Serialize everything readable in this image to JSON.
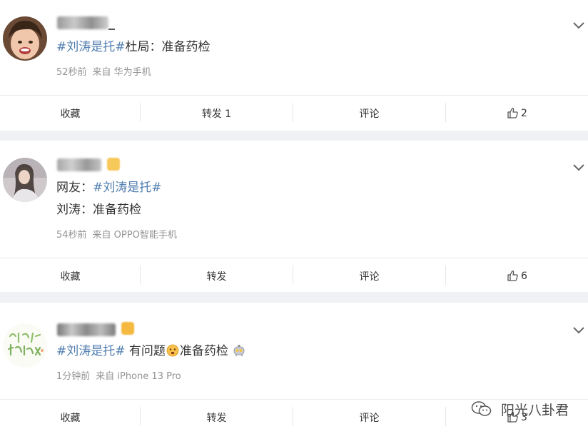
{
  "posts": [
    {
      "content": {
        "tag": "#刘涛是托#",
        "text": "杜局：准备药检"
      },
      "meta": {
        "time": "52秒前",
        "source": "来自 华为手机"
      },
      "actions": {
        "fav": "收藏",
        "repost": "转发 1",
        "comment": "评论",
        "like_count": "2"
      }
    },
    {
      "content": {
        "line1_prefix": "网友：",
        "tag": "#刘涛是托#",
        "line2": "刘涛：准备药检"
      },
      "meta": {
        "time": "54秒前",
        "source": "来自 OPPO智能手机"
      },
      "actions": {
        "fav": "收藏",
        "repost": "转发",
        "comment": "评论",
        "like_count": "6"
      }
    },
    {
      "content": {
        "tag": "#刘涛是托#",
        "text_a": "有问题",
        "text_b": "准备药检"
      },
      "meta": {
        "time": "1分钟前",
        "source": "来自 iPhone 13 Pro"
      },
      "actions": {
        "fav": "收藏",
        "repost": "转发",
        "comment": "评论",
        "like_count": "3"
      }
    }
  ],
  "watermark": {
    "label": "阳光八卦君",
    "icon": "wechat-icon"
  },
  "colors": {
    "tag": "#507daf",
    "meta": "#939393",
    "text": "#333333",
    "separator": "#f0f1f4"
  }
}
